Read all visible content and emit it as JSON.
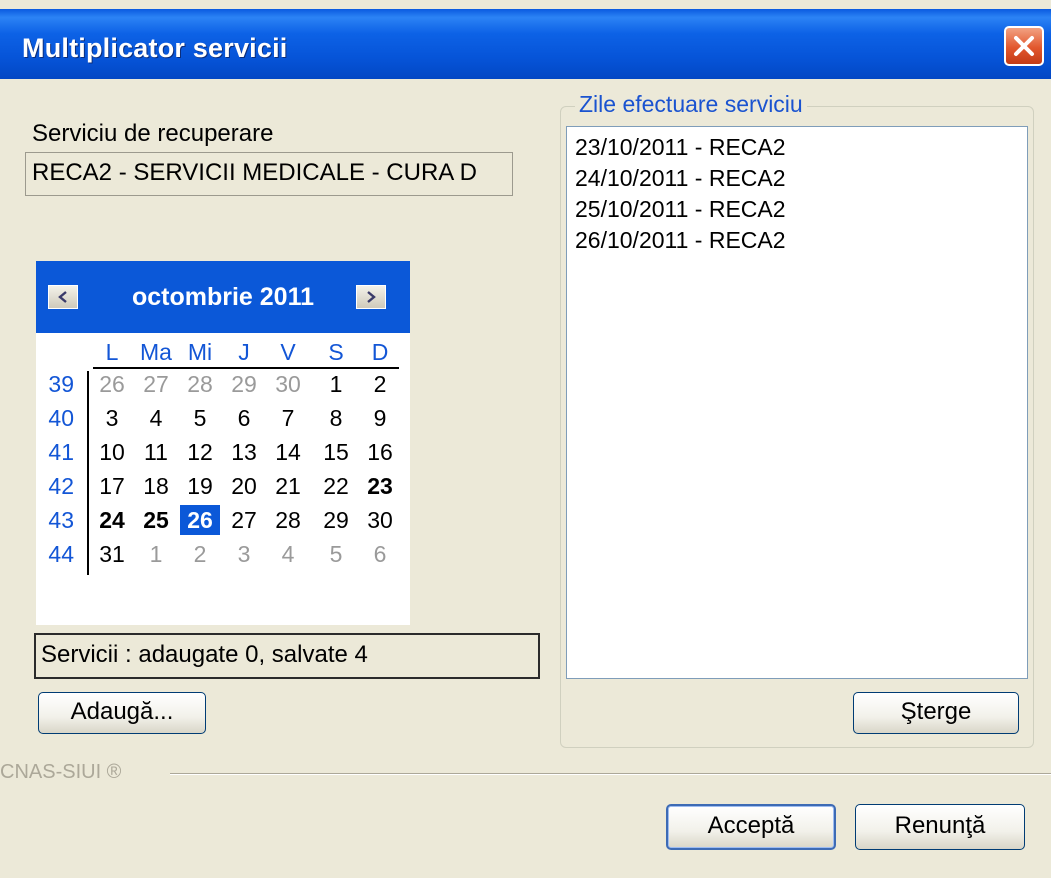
{
  "window": {
    "title": "Multiplicator servicii"
  },
  "service": {
    "label": "Serviciu de recuperare",
    "value": "RECA2 - SERVICII MEDICALE - CURA D"
  },
  "calendar": {
    "month_label": "octombrie 2011",
    "prev_icon": "chevron-left-icon",
    "next_icon": "chevron-right-icon",
    "day_headers": [
      "L",
      "Ma",
      "Mi",
      "J",
      "V",
      "S",
      "D"
    ],
    "weeks": [
      {
        "num": "39",
        "days": [
          {
            "d": "26",
            "other": true
          },
          {
            "d": "27",
            "other": true
          },
          {
            "d": "28",
            "other": true
          },
          {
            "d": "29",
            "other": true
          },
          {
            "d": "30",
            "other": true
          },
          {
            "d": "1"
          },
          {
            "d": "2"
          }
        ]
      },
      {
        "num": "40",
        "days": [
          {
            "d": "3"
          },
          {
            "d": "4"
          },
          {
            "d": "5"
          },
          {
            "d": "6"
          },
          {
            "d": "7"
          },
          {
            "d": "8"
          },
          {
            "d": "9"
          }
        ]
      },
      {
        "num": "41",
        "days": [
          {
            "d": "10"
          },
          {
            "d": "11"
          },
          {
            "d": "12"
          },
          {
            "d": "13"
          },
          {
            "d": "14"
          },
          {
            "d": "15"
          },
          {
            "d": "16"
          }
        ]
      },
      {
        "num": "42",
        "days": [
          {
            "d": "17"
          },
          {
            "d": "18"
          },
          {
            "d": "19"
          },
          {
            "d": "20"
          },
          {
            "d": "21"
          },
          {
            "d": "22"
          },
          {
            "d": "23",
            "bold": true
          }
        ]
      },
      {
        "num": "43",
        "days": [
          {
            "d": "24",
            "bold": true
          },
          {
            "d": "25",
            "bold": true
          },
          {
            "d": "26",
            "selected": true
          },
          {
            "d": "27"
          },
          {
            "d": "28"
          },
          {
            "d": "29"
          },
          {
            "d": "30"
          }
        ]
      },
      {
        "num": "44",
        "days": [
          {
            "d": "31"
          },
          {
            "d": "1",
            "other": true
          },
          {
            "d": "2",
            "other": true
          },
          {
            "d": "3",
            "other": true
          },
          {
            "d": "4",
            "other": true
          },
          {
            "d": "5",
            "other": true
          },
          {
            "d": "6",
            "other": true
          }
        ]
      }
    ]
  },
  "status": {
    "text": "Servicii : adaugate 0, salvate 4"
  },
  "buttons": {
    "add": "Adaugă...",
    "delete": "Şterge",
    "accept": "Acceptă",
    "cancel": "Renunţă"
  },
  "days_group": {
    "title": "Zile efectuare serviciu",
    "items": [
      "23/10/2011 - RECA2",
      "24/10/2011 - RECA2",
      "25/10/2011 - RECA2",
      "26/10/2011 - RECA2"
    ]
  },
  "footer": {
    "label": "CNAS-SIUI ®"
  },
  "colors": {
    "titlebar": "#0654d8",
    "calendar_header": "#0b58d8",
    "accent_text": "#1356d6",
    "dialog_bg": "#ece9d8",
    "close_button": "#e2572d"
  }
}
